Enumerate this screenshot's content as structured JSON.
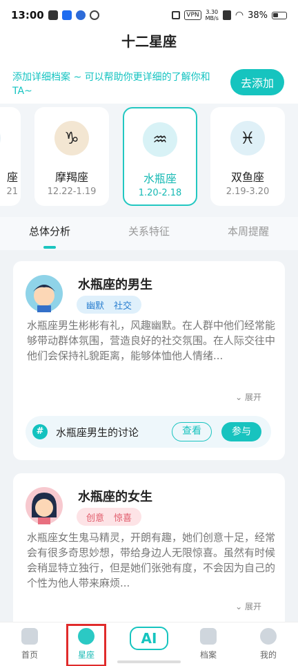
{
  "status_bar": {
    "time": "13:00",
    "vpn": "VPN",
    "speed_value": "3.30",
    "speed_unit": "MB/s",
    "battery": "38%"
  },
  "title": "十二星座",
  "banner": {
    "text": "添加详细档案 ~ 可以帮助你更详细的了解你和TA~",
    "button": "去添加"
  },
  "signs": [
    {
      "name": "座",
      "date": "21",
      "icon": "capricorn-partial-emblem"
    },
    {
      "name": "摩羯座",
      "date": "12.22-1.19",
      "icon": "capricorn-emblem"
    },
    {
      "name": "水瓶座",
      "date": "1.20-2.18",
      "icon": "aquarius-emblem",
      "selected": true
    },
    {
      "name": "双鱼座",
      "date": "2.19-3.20",
      "icon": "pisces-emblem"
    }
  ],
  "tabs": [
    "总体分析",
    "关系特征",
    "本周提醒"
  ],
  "male_card": {
    "title": "水瓶座的男生",
    "tags": [
      "幽默",
      "社交"
    ],
    "text": "水瓶座男生彬彬有礼，风趣幽默。在人群中他们经常能够带动群体氛围，营造良好的社交氛围。在人际交往中他们会保持礼貌距离，能够体恤他人情绪...",
    "expand": "展开",
    "discussion": "水瓶座男生的讨论",
    "view": "查看",
    "join": "参与"
  },
  "female_card": {
    "title": "水瓶座的女生",
    "tags": [
      "创意",
      "惊喜"
    ],
    "text": "水瓶座女生鬼马精灵，开朗有趣，她们创意十足，经常会有很多奇思妙想，带给身边人无限惊喜。虽然有时候会稍显特立独行，但是她们张弛有度，不会因为自己的个性为他人带来麻烦...",
    "expand": "展开"
  },
  "nav": {
    "home": "首页",
    "sign": "星座",
    "ai": "AI",
    "archive": "档案",
    "mine": "我的"
  },
  "colors": {
    "accent": "#16c4bf",
    "highlight": "#e02b2b"
  }
}
